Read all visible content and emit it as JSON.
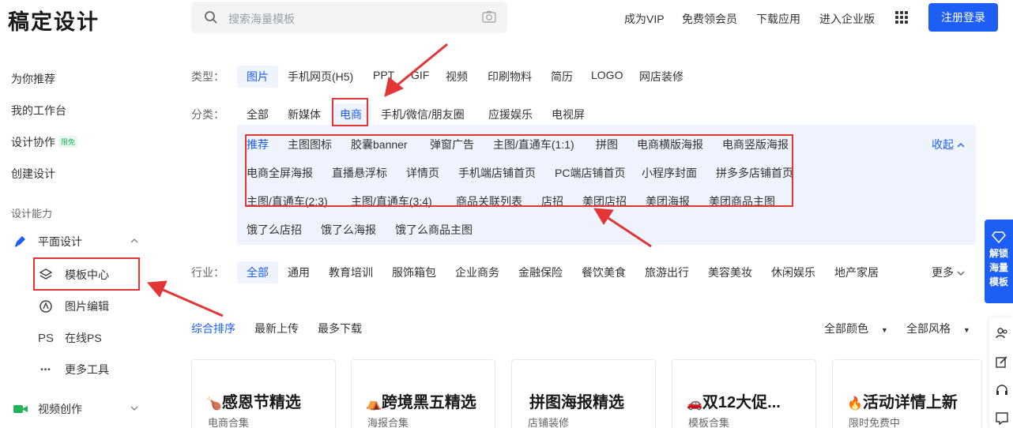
{
  "header": {
    "logo": "稿定设计",
    "search_placeholder": "搜索海量模板",
    "nav": [
      "成为VIP",
      "免费领会员",
      "下载应用",
      "进入企业版"
    ],
    "register_label": "注册登录"
  },
  "sidebar": {
    "items": [
      "为你推荐",
      "我的工作台",
      "设计协作",
      "创建设计"
    ],
    "collab_badge": "限免",
    "section_label": "设计能力",
    "flat_design": "平面设计",
    "sub_items": [
      {
        "label": "模板中心",
        "icon": "layers-icon"
      },
      {
        "label": "图片编辑",
        "icon": "image-edit-icon"
      },
      {
        "label": "在线PS",
        "icon": "ps-icon"
      },
      {
        "label": "更多工具",
        "icon": "more-icon"
      }
    ],
    "ps_glyph": "PS",
    "more_glyph": "•••",
    "video": "视频创作"
  },
  "filters": {
    "type_label": "类型：",
    "types": [
      "图片",
      "手机网页(H5)",
      "PPT",
      "GIF",
      "视频",
      "印刷物料",
      "简历",
      "LOGO",
      "网店装修"
    ],
    "category_label": "分类：",
    "categories": [
      "全部",
      "新媒体",
      "电商",
      "手机/微信/朋友圈",
      "应援娱乐",
      "电视屏"
    ],
    "sub_row1": [
      "推荐",
      "主图图标",
      "胶囊banner",
      "弹窗广告",
      "主图/直通车(1:1)",
      "拼图",
      "电商横版海报",
      "电商竖版海报"
    ],
    "sub_row2": [
      "电商全屏海报",
      "直播悬浮标",
      "详情页",
      "手机端店铺首页",
      "PC端店铺首页",
      "小程序封面",
      "拼多多店铺首页"
    ],
    "sub_row3": [
      "主图/直通车(2:3)",
      "主图/直通车(3:4)",
      "商品关联列表",
      "店招",
      "美团店招",
      "美团海报",
      "美团商品主图"
    ],
    "sub_row4": [
      "饿了么店招",
      "饿了么海报",
      "饿了么商品主图"
    ],
    "collapse": "收起",
    "industry_label": "行业：",
    "industries": [
      "全部",
      "通用",
      "教育培训",
      "服饰箱包",
      "企业商务",
      "金融保险",
      "餐饮美食",
      "旅游出行",
      "美容美妆",
      "休闲娱乐",
      "地产家居"
    ],
    "more": "更多"
  },
  "sort": {
    "options": [
      "综合排序",
      "最新上传",
      "最多下载"
    ],
    "color": "全部颜色",
    "style": "全部风格"
  },
  "cards": [
    {
      "title": "感恩节精选",
      "sub": "电商合集",
      "emoji": "🍗"
    },
    {
      "title": "跨境黑五精选",
      "sub": "海报合集",
      "emoji": "⛺"
    },
    {
      "title": "拼图海报精选",
      "sub": "店铺装修",
      "emoji": ""
    },
    {
      "title": "双12大促...",
      "sub": "模板合集",
      "emoji": "🚗"
    },
    {
      "title": "活动详情上新",
      "sub": "限时免费中",
      "emoji": "🔥"
    }
  ],
  "unlock": [
    "解锁",
    "海量",
    "模板"
  ],
  "colors": {
    "accent": "#1d5ef5",
    "highlight": "#e23636",
    "panel": "#eef3fd"
  }
}
